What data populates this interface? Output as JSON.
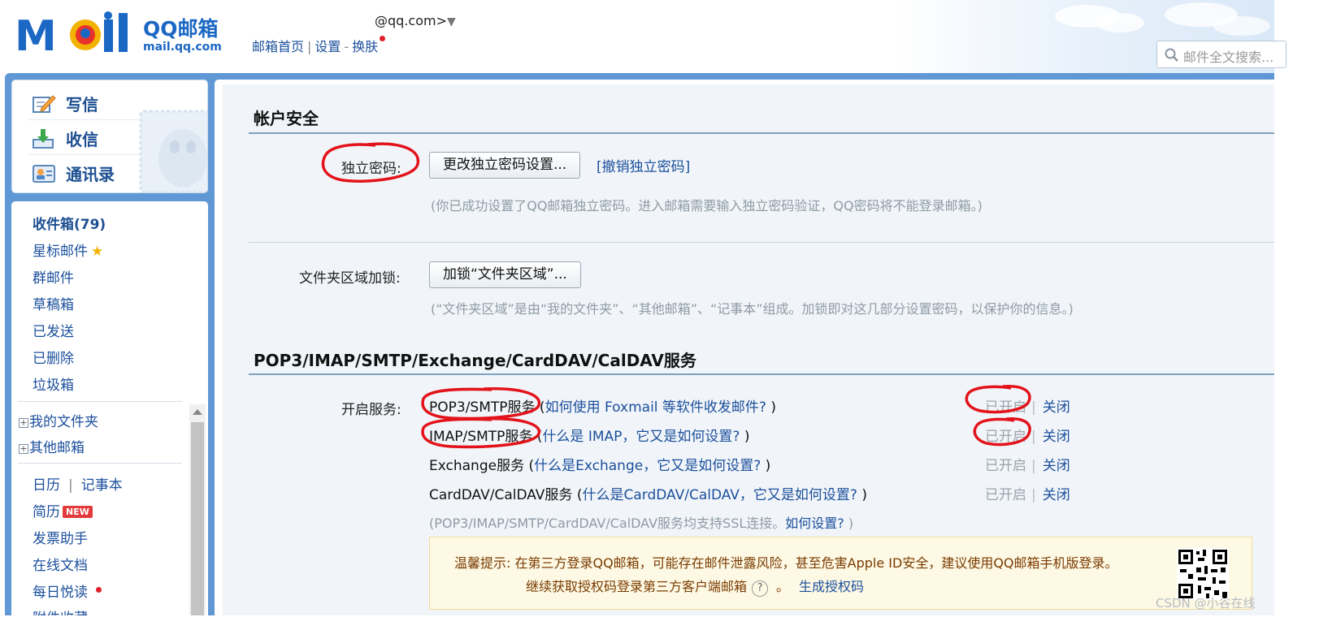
{
  "header": {
    "logo_text": "MOil",
    "logo_brand": "QQ邮箱",
    "logo_url": "mail.qq.com",
    "account": "@qq.com>",
    "account_arrow": "▼",
    "nav": [
      "邮箱首页",
      "设置",
      "换肤"
    ],
    "nav_sep1": "|",
    "nav_sep2": "-",
    "search_placeholder": "邮件全文搜索..."
  },
  "compose": {
    "write": "写信",
    "receive": "收信",
    "contacts": "通讯录"
  },
  "folders": {
    "inbox": "收件箱(79)",
    "starred": "星标邮件",
    "star_glyph": "★",
    "group": "群邮件",
    "drafts": "草稿箱",
    "sent": "已发送",
    "deleted": "已删除",
    "spam": "垃圾箱",
    "my_folders": "我的文件夹",
    "other_mail": "其他邮箱",
    "plus_glyph": "+",
    "calendar": "日历",
    "calendar_sep": "|",
    "notepad": "记事本",
    "resume": "简历",
    "resume_badge": "NEW",
    "invoice": "发票助手",
    "docs": "在线文档",
    "daily": "每日悦读",
    "attachments": "附件收藏"
  },
  "account_security": {
    "title": "帐户安全",
    "password_label": "独立密码:",
    "change_button": "更改独立密码设置...",
    "revoke_link": "[撤销独立密码]",
    "password_note": "(你已成功设置了QQ邮箱独立密码。进入邮箱需要输入独立密码验证，QQ密码将不能登录邮箱。)",
    "folder_lock_label": "文件夹区域加锁:",
    "lock_button": "加锁“文件夹区域”...",
    "lock_note": "(“文件夹区域”是由“我的文件夹”、“其他邮箱”、“记事本”组成。加锁即对这几部分设置密码，以保护你的信息。)"
  },
  "services": {
    "title": "POP3/IMAP/SMTP/Exchange/CardDAV/CalDAV服务",
    "enable_label": "开启服务:",
    "rows": [
      {
        "name": "POP3/SMTP服务",
        "help_open": " (",
        "help": "如何使用 Foxmail 等软件收发邮件?",
        "help_close": " )",
        "status": "已开启",
        "sep": "|",
        "action": "关闭"
      },
      {
        "name": "IMAP/SMTP服务",
        "help_open": " (",
        "help": "什么是 IMAP，它又是如何设置?",
        "help_close": " )",
        "status": "已开启",
        "sep": "|",
        "action": "关闭"
      },
      {
        "name": "Exchange服务",
        "help_open": " (",
        "help": "什么是Exchange，它又是如何设置?",
        "help_close": " )",
        "status": "已开启",
        "sep": "|",
        "action": "关闭"
      },
      {
        "name": "CardDAV/CalDAV服务",
        "help_open": " (",
        "help": "什么是CardDAV/CalDAV，它又是如何设置?",
        "help_close": " )",
        "status": "已开启",
        "sep": "|",
        "action": "关闭"
      }
    ],
    "ssl_note": "(POP3/IMAP/SMTP/CardDAV/CalDAV服务均支持SSL连接。",
    "ssl_link": "如何设置?",
    "ssl_note_end": " )",
    "tip_line1": "温馨提示: 在第三方登录QQ邮箱，可能存在邮件泄露风险，甚至危害Apple ID安全，建议使用QQ邮箱手机版登录。",
    "tip_line2": "继续获取授权码登录第三方客户端邮箱",
    "tip_help": "?",
    "tip_period": "。",
    "generate_link": "生成授权码"
  },
  "watermark": "CSDN @小谷在线",
  "colors": {
    "brand_blue": "#1b67c4",
    "link_blue": "#1b4f9c",
    "frame_blue": "#5f98d4",
    "annotation_red": "#e3131b"
  }
}
